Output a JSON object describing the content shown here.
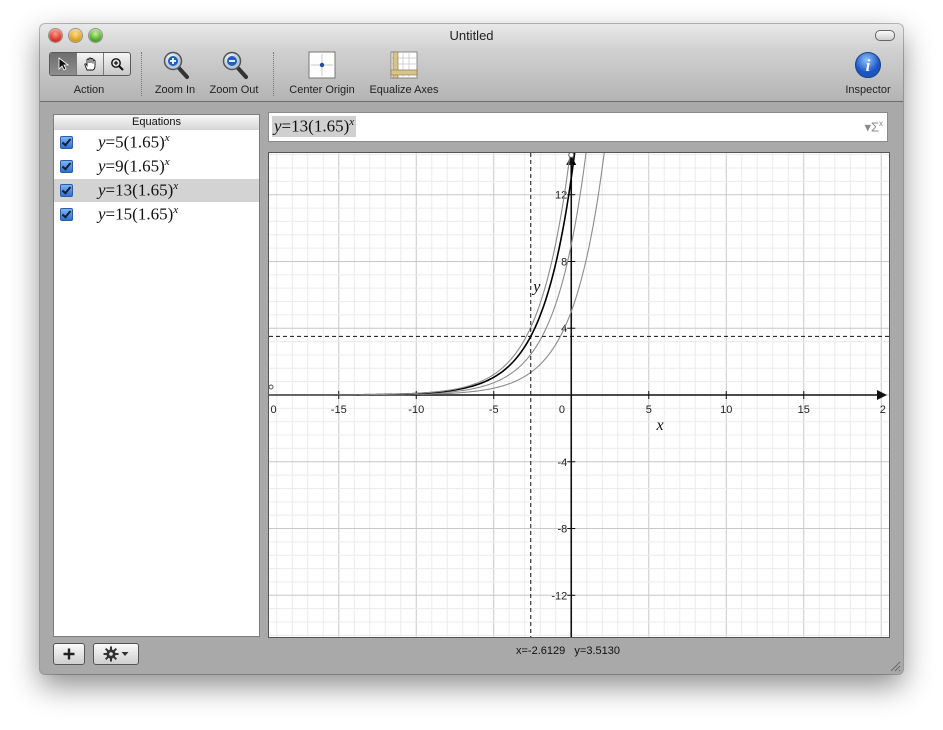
{
  "window": {
    "title": "Untitled"
  },
  "toolbar": {
    "action_label": "Action",
    "zoom_in_label": "Zoom In",
    "zoom_out_label": "Zoom Out",
    "center_origin_label": "Center Origin",
    "equalize_axes_label": "Equalize Axes",
    "inspector_label": "Inspector"
  },
  "sidebar": {
    "header": "Equations",
    "equations": [
      {
        "coef": "5",
        "base": "1.65",
        "checked": true,
        "selected": false
      },
      {
        "coef": "9",
        "base": "1.65",
        "checked": true,
        "selected": false
      },
      {
        "coef": "13",
        "base": "1.65",
        "checked": true,
        "selected": true
      },
      {
        "coef": "15",
        "base": "1.65",
        "checked": true,
        "selected": false
      }
    ]
  },
  "equation_bar": {
    "coef": "13",
    "base": "1.65"
  },
  "graph": {
    "x_tick_labels": [
      "0",
      "-15",
      "-10",
      "-5",
      "0",
      "5",
      "10",
      "15",
      "2"
    ],
    "y_tick_labels": [
      "12",
      "8",
      "4",
      "-4",
      "-8",
      "-12"
    ],
    "x_axis_label": "x",
    "y_axis_label": "y",
    "cursor": {
      "x": -2.6129,
      "y": 3.513
    }
  },
  "status": {
    "coords_text": "x=-2.6129   y=3.5130"
  },
  "chart_data": {
    "type": "line",
    "series": [
      {
        "coef": 5,
        "base": 1.65
      },
      {
        "coef": 9,
        "base": 1.65
      },
      {
        "coef": 13,
        "base": 1.65
      },
      {
        "coef": 15,
        "base": 1.65
      }
    ],
    "highlighted_series": 2,
    "xlim": [
      -19.5,
      20.5
    ],
    "ylim": [
      -14.5,
      14.5
    ],
    "x_ticks": [
      -15,
      -10,
      -5,
      0,
      5,
      10,
      15
    ],
    "y_ticks": [
      -12,
      -8,
      -4,
      4,
      8,
      12
    ],
    "grid": true,
    "xlabel": "x",
    "ylabel": "y"
  }
}
